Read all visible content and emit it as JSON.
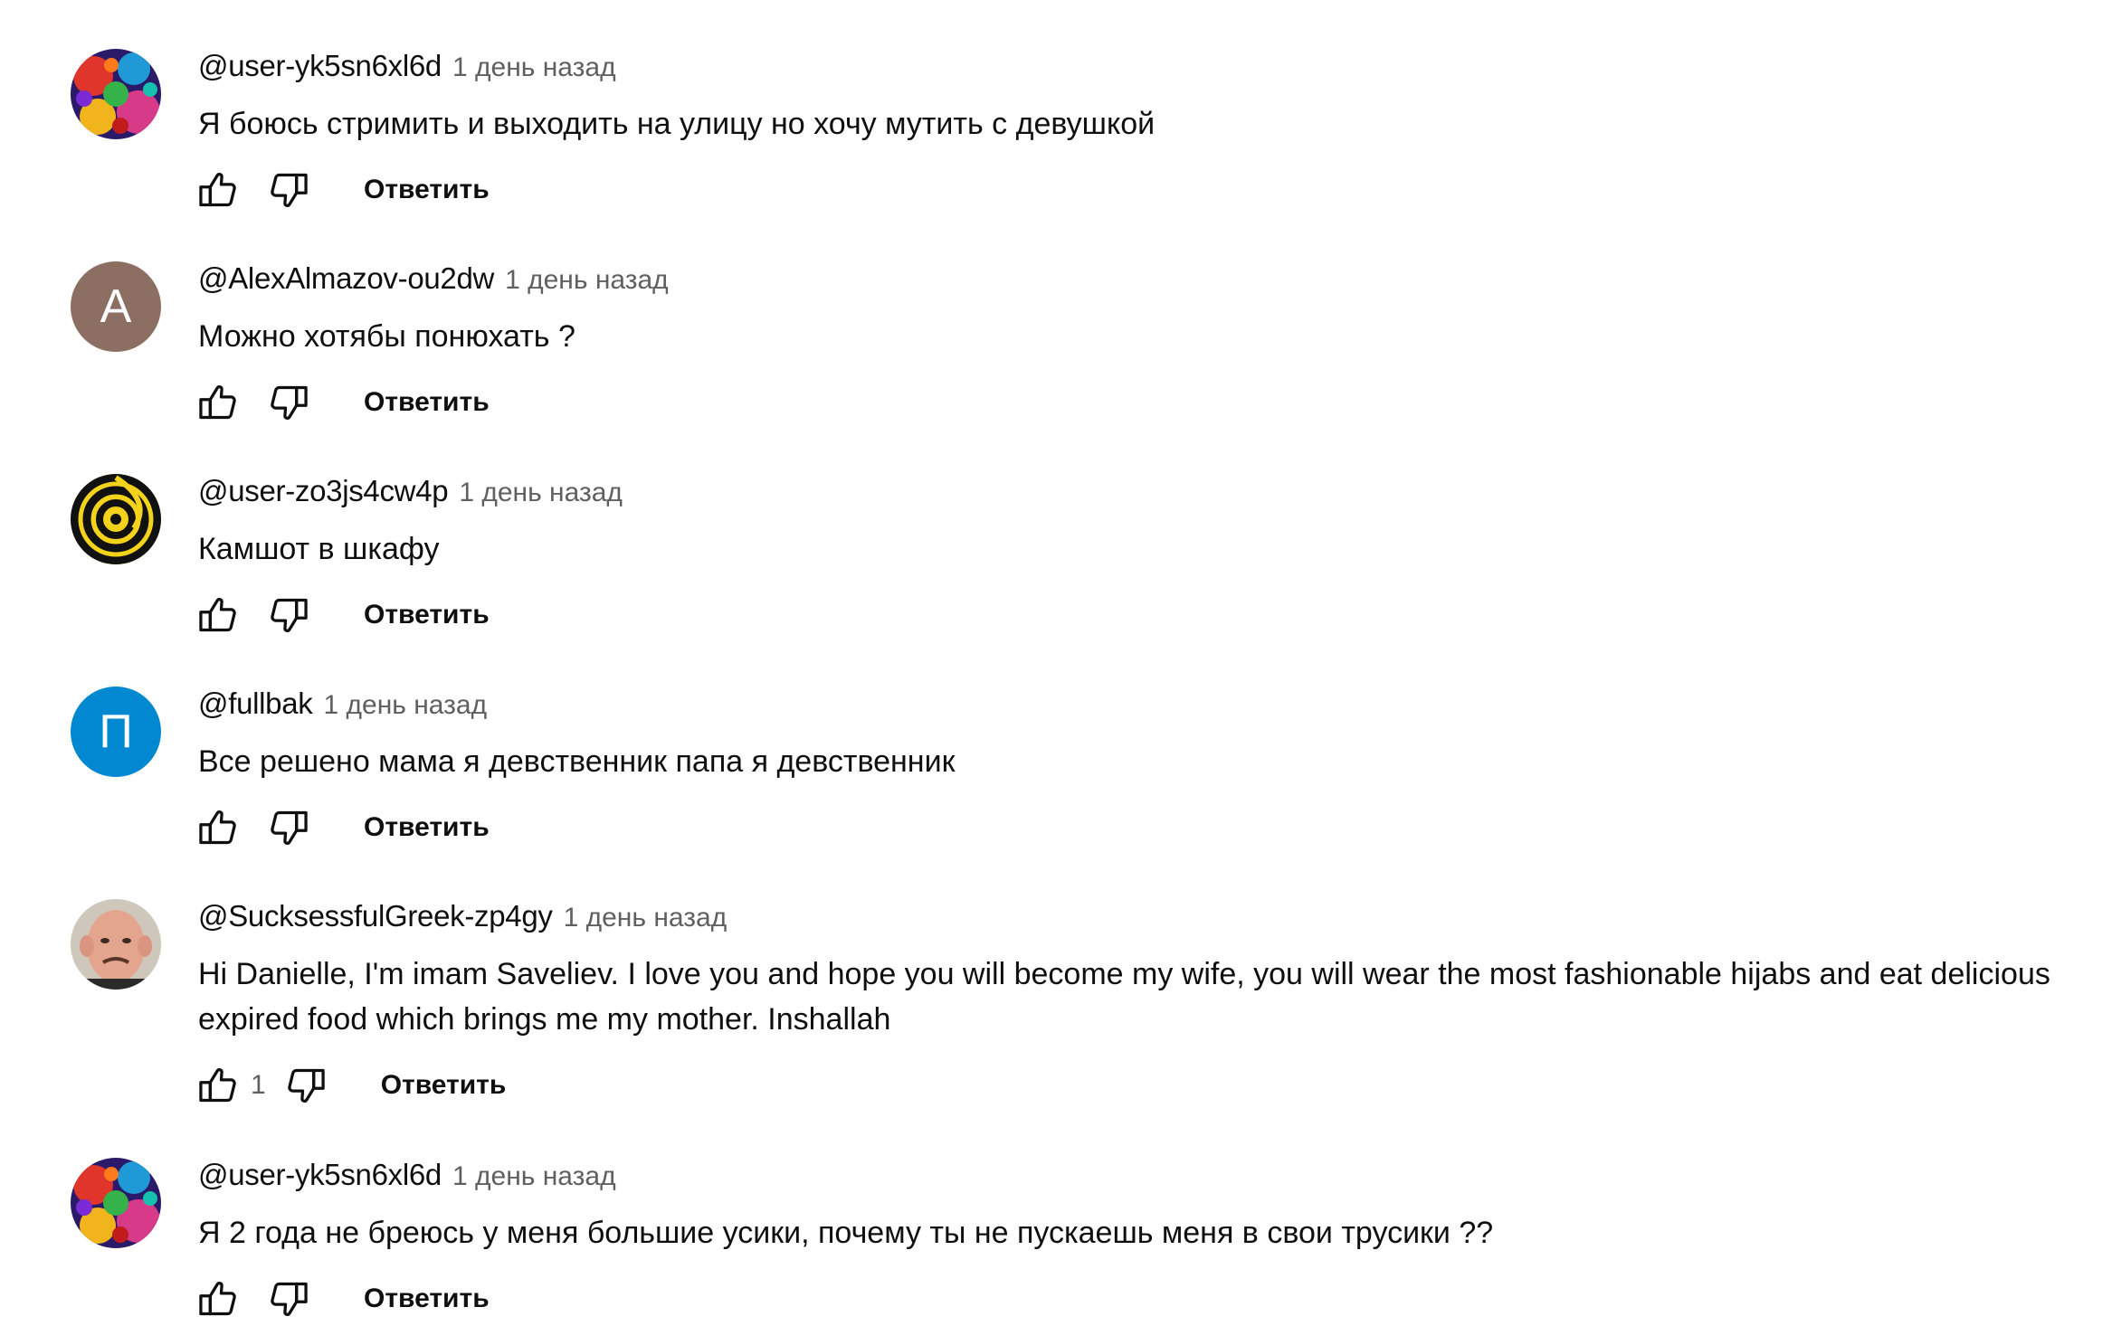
{
  "colors": {
    "text_primary": "#0f0f0f",
    "text_secondary": "#606060",
    "avatar_brown": "#8d6e63",
    "avatar_blue": "#0288d1",
    "icon_stroke": "#0f0f0f"
  },
  "comments": [
    {
      "author": "@user-yk5sn6xl6d",
      "time": "1 день назад",
      "text": "Я боюсь стримить и выходить на улицу но хочу мутить с девушкой",
      "reply_label": "Ответить",
      "avatar": "colorful-pattern-avatar"
    },
    {
      "author": "@AlexAlmazov-ou2dw",
      "time": "1 день назад",
      "text": "Можно хотябы понюхать ?",
      "reply_label": "Ответить",
      "avatar_letter": "A"
    },
    {
      "author": "@user-zo3js4cw4p",
      "time": "1 день назад",
      "text": "Камшот в шкафу",
      "reply_label": "Ответить",
      "avatar": "yellow-black-swirl-avatar"
    },
    {
      "author": "@fullbak",
      "time": "1 день назад",
      "text": "Все решено мама я девственник папа я девственник",
      "reply_label": "Ответить",
      "avatar_letter": "П"
    },
    {
      "author": "@SucksessfulGreek-zp4gy",
      "time": "1 день назад",
      "text": "Hi Danielle, I'm imam Saveliev. I love you and hope you will become my wife, you will wear the most fashionable hijabs and eat delicious expired food which brings me my mother. Inshallah",
      "like_count": "1",
      "reply_label": "Ответить",
      "avatar": "face-photo-avatar"
    },
    {
      "author": "@user-yk5sn6xl6d",
      "time": "1 день назад",
      "text": "Я 2 года не бреюсь у меня большие усики, почему ты не пускаешь меня в свои трусики ??",
      "reply_label": "Ответить",
      "avatar": "colorful-pattern-avatar"
    }
  ]
}
